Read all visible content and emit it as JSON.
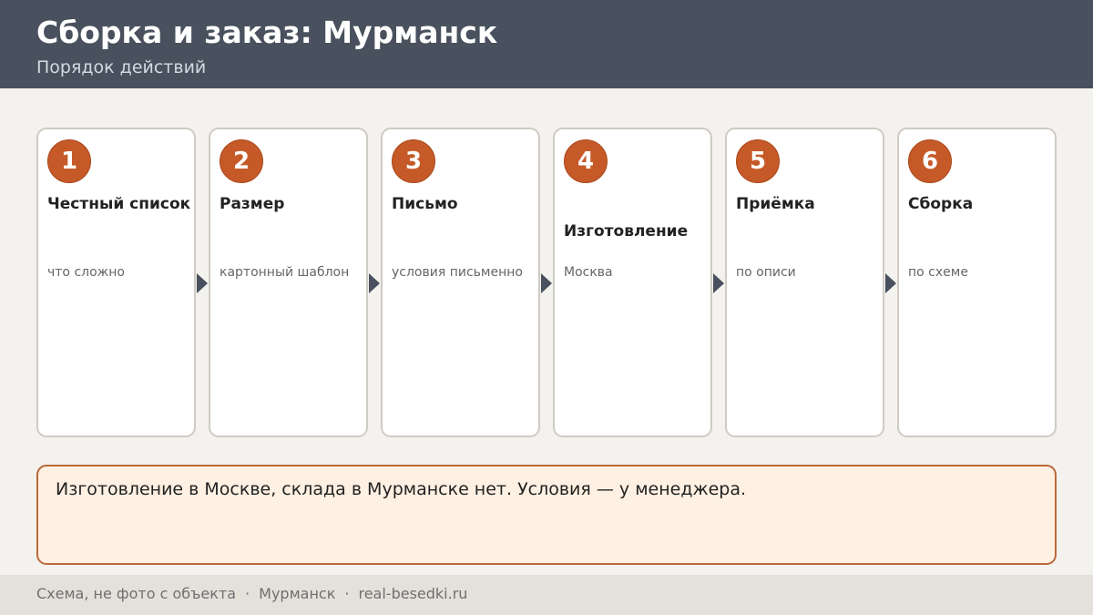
{
  "header": {
    "title": "Сборка и заказ: Мурманск",
    "subtitle": "Порядок действий"
  },
  "steps": [
    {
      "number": "1",
      "title": "Честный список",
      "description": "что сложно"
    },
    {
      "number": "2",
      "title": "Размер",
      "description": "картонный шаблон"
    },
    {
      "number": "3",
      "title": "Письмо",
      "description": "условия письменно"
    },
    {
      "number": "4",
      "title": "Изготовление",
      "description": "Москва"
    },
    {
      "number": "5",
      "title": "Приёмка",
      "description": "по описи"
    },
    {
      "number": "6",
      "title": "Сборка",
      "description": "по схеме"
    }
  ],
  "note": {
    "text": "Изготовление в Москве, склада в Мурманске нет. Условия — у менеджера."
  },
  "footer": {
    "caption": "Схема, не фото с объекта",
    "separator": "·",
    "city": "Мурманск",
    "site": "real-besedki.ru"
  },
  "colors": {
    "header_bg": "#48515d",
    "accent": "#c55a28",
    "note_bg": "#fef0e2",
    "note_border": "#b9693a",
    "page_bg": "#f4f2ee"
  }
}
